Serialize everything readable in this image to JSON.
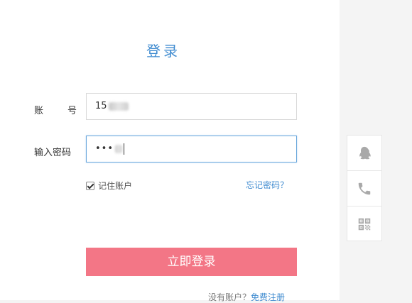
{
  "login": {
    "title": "登录",
    "account_label_left": "账",
    "account_label_right": "号",
    "account_value_prefix": "15",
    "password_label": "输入密码",
    "password_masked": "•••",
    "remember_label": "记住账户",
    "forgot_link": "忘记密码？",
    "submit_label": "立即登录",
    "no_account_text": "没有账户？",
    "register_link": "免费注册"
  },
  "side_login_options": [
    {
      "icon": "qq-icon",
      "label": "QQ"
    },
    {
      "icon": "phone-icon",
      "label": "Phone"
    },
    {
      "icon": "qr-code-icon",
      "label": "QR code"
    }
  ],
  "colors": {
    "accent_blue": "#3f8bd0",
    "login_button": "#f37686",
    "page_bg": "#f4f4f4"
  }
}
